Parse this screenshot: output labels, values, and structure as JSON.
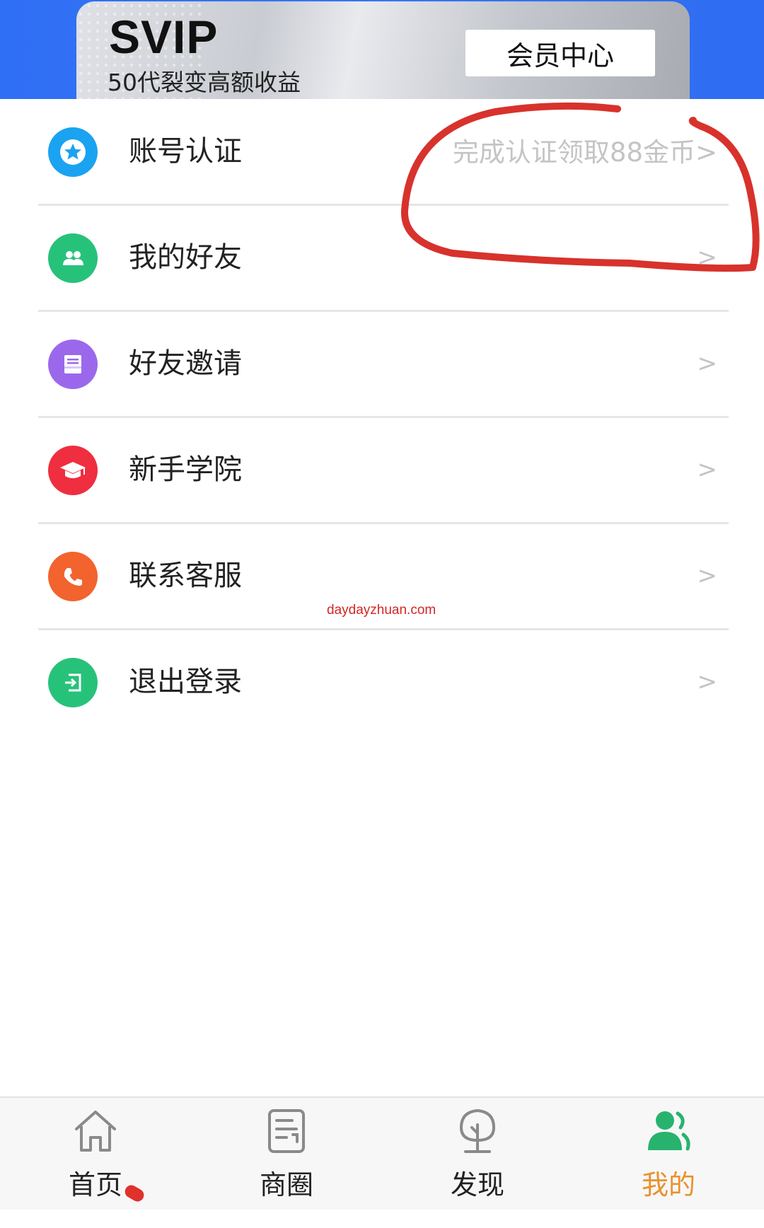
{
  "banner": {
    "title": "SVIP",
    "subtitle": "50代裂变高额收益",
    "member_center_label": "会员中心"
  },
  "colors": {
    "banner_blue": "#2f6ff5",
    "active_tab": "#e8922d",
    "annotation_red": "#d8322c"
  },
  "menu": {
    "items": [
      {
        "label": "账号认证",
        "hint": "完成认证领取88金币>",
        "icon": "star-badge-icon",
        "color": "#1aa3f0"
      },
      {
        "label": "我的好友",
        "chevron": ">",
        "icon": "friends-icon",
        "color": "#27c27a"
      },
      {
        "label": "好友邀请",
        "chevron": ">",
        "icon": "invite-card-icon",
        "color": "#9b68ec"
      },
      {
        "label": "新手学院",
        "chevron": ">",
        "icon": "graduation-cap-icon",
        "color": "#ef2e40"
      },
      {
        "label": "联系客服",
        "chevron": ">",
        "icon": "phone-icon",
        "color": "#f2632e"
      },
      {
        "label": "退出登录",
        "chevron": ">",
        "icon": "logout-icon",
        "color": "#27c27a"
      }
    ]
  },
  "watermark": "daydayzhuan.com",
  "tabbar": {
    "tabs": [
      {
        "label": "首页",
        "icon": "home-icon"
      },
      {
        "label": "商圈",
        "icon": "document-icon"
      },
      {
        "label": "发现",
        "icon": "tree-icon"
      },
      {
        "label": "我的",
        "icon": "user-profile-icon",
        "active": true
      }
    ]
  }
}
